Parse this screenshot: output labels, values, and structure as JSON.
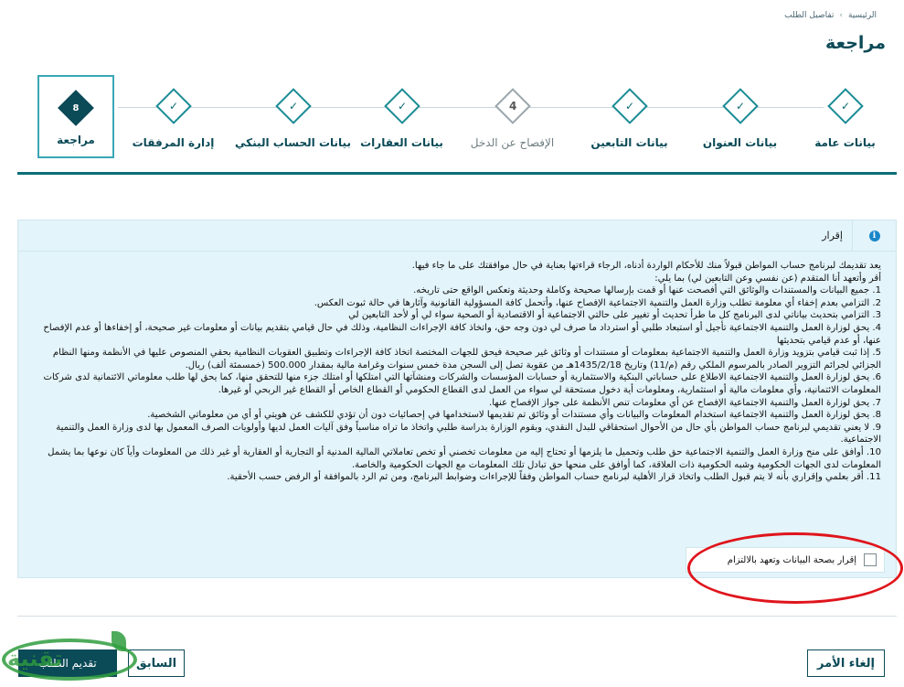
{
  "breadcrumb": {
    "home": "الرئيسية",
    "separator": "›",
    "current": "تفاصيل الطلب"
  },
  "page_title": "مراجعة",
  "steps": [
    {
      "label": "بيانات عامة",
      "state": "done",
      "glyph": "✓"
    },
    {
      "label": "بيانات العنوان",
      "state": "done",
      "glyph": "✓"
    },
    {
      "label": "بيانات التابعين",
      "state": "done",
      "glyph": "✓"
    },
    {
      "label": "الإفصاح عن الدخل",
      "state": "pending",
      "glyph": "4"
    },
    {
      "label": "بيانات العقارات",
      "state": "done",
      "glyph": "✓"
    },
    {
      "label": "بيانات الحساب البنكي",
      "state": "done",
      "glyph": "✓"
    },
    {
      "label": "إدارة المرفقات",
      "state": "done",
      "glyph": "✓"
    },
    {
      "label": "مراجعة",
      "state": "current",
      "glyph": "8"
    }
  ],
  "panel": {
    "title": "إقرار",
    "info_icon": "info-icon",
    "paragraphs": [
      "يعد تقديمك لبرنامج حساب المواطن قبولاً منك للأحكام الواردة أدناه، الرجاء قراءتها بعناية في حال موافقتك على ما جاء فيها.",
      "أقر وأتعهد أنا المتقدم (عن نفسي وعن التابعين لي) بما يلي:",
      "1. جميع البيانات والمستندات والوثائق التي أفصحت عنها أو قمت بإرسالها صحيحة وكاملة وحديثة وتعكس الواقع حتى تاريخه.",
      "2. التزامي بعدم إخفاء أي معلومة تطلب وزارة العمل والتنمية الاجتماعية الإفصاح عنها، وأتحمل كافة المسؤولية القانونية وآثارها في حالة ثبوت العكس.",
      "3. التزامي بتحديث بياناتي لدى البرنامج كل ما طرأ تحديث أو تغيير على حالتي الاجتماعية أو الاقتصادية أو الصحية سواء لي أو لأحد التابعين لي",
      "4. يحق لوزارة العمل والتنمية الاجتماعية تأجيل أو استبعاد طلبي أو استرداد ما صرف لي دون وجه حق، واتخاذ كافة الإجراءات النظامية، وذلك في حال قيامي بتقديم بيانات أو معلومات غير صحيحة، أو إخفاءها أو عدم الإفصاح عنها، أو عدم قيامي بتحديثها",
      "5. إذا ثبت قيامي بتزويد وزارة العمل والتنمية الاجتماعية بمعلومات أو مستندات أو وثائق غير صحيحة فيحق للجهات المختصة اتخاذ كافة الإجراءات وتطبيق العقوبات النظامية بحقي المنصوص عليها في الأنظمة ومنها النظام الجزائي لجرائم التزوير الصادر بالمرسوم الملكي رقم (م/11) وتاريخ 1435/2/18هـ من عقوبة تصل إلى السجن مدة خمس سنوات وغرامة مالية بمقدار 500.000 (خمسمئة ألف) ريال.",
      "6. يحق لوزارة العمل والتنمية الاجتماعية الاطلاع على حساباتي البنكية والاستثمارية أو حسابات المؤسسات والشركات ومنشآتها التي امتلكها أو امتلك جزء منها للتحقق منها، كما يحق لها طلب معلوماتي الائتمانية لدى شركات المعلومات الائتمانية، وأي معلومات مالية أو استثمارية، ومعلومات أية دخول مستحقة لي سواء من العمل لدى القطاع الحكومي أو القطاع الخاص أو القطاع غير الربحي أو غيرها.",
      "7. يحق لوزارة العمل والتنمية الاجتماعية الإفصاح عن أي معلومات تنص الأنظمة على جواز الإفصاح عنها.",
      "8. يحق لوزارة العمل والتنمية الاجتماعية استخدام المعلومات والبيانات وأي مستندات أو وثائق تم تقديمها لاستخدامها في إحصائيات دون أن تؤدي للكشف عن هويتي أو أي من معلوماتي الشخصية.",
      "9. لا يعني تقديمي لبرنامج حساب المواطن بأي حال من الأحوال استحقاقي للبدل النقدي، وبقوم الوزارة بدراسة طلبي واتخاذ ما تراه مناسباً وفق آليات العمل لديها وأولويات الصرف المعمول بها لدى وزارة العمل والتنمية الاجتماعية.",
      "10. أوافق على منح وزارة العمل والتنمية الاجتماعية حق طلب وتحميل ما يلزمها أو تحتاج إليه من معلومات تخصني أو تخص تعاملاتي المالية المدنية أو التجارية أو العقارية أو غير ذلك من المعلومات وأياً كان نوعها بما يشمل المعلومات لدى الجهات الحكومية وشبه الحكومية ذات العلاقة، كما أوافق على منحها حق تبادل تلك المعلومات مع الجهات الحكومية والخاصة.",
      "11. أقر بعلمي وإقراري بأنه لا يتم قبول الطلب واتخاذ قرار الأهلية لبرنامج حساب المواطن وفقاً للإجراءات وضوابط البرنامج، ومن ثم الرد بالموافقة أو الرفض حسب الأحقية."
    ],
    "confirm_label": "إقرار بصحة البيانات وتعهد بالالتزام"
  },
  "buttons": {
    "cancel": "إلغاء الأمر",
    "previous": "السابق",
    "submit": "تقديم الطلب"
  },
  "watermark": {
    "text": "تقنية"
  },
  "colors": {
    "primary": "#0b4a57",
    "accent": "#1a8b95",
    "panel_bg": "#e3f4fa",
    "annotation": "#e0141c",
    "watermark": "#2f9c3e"
  }
}
